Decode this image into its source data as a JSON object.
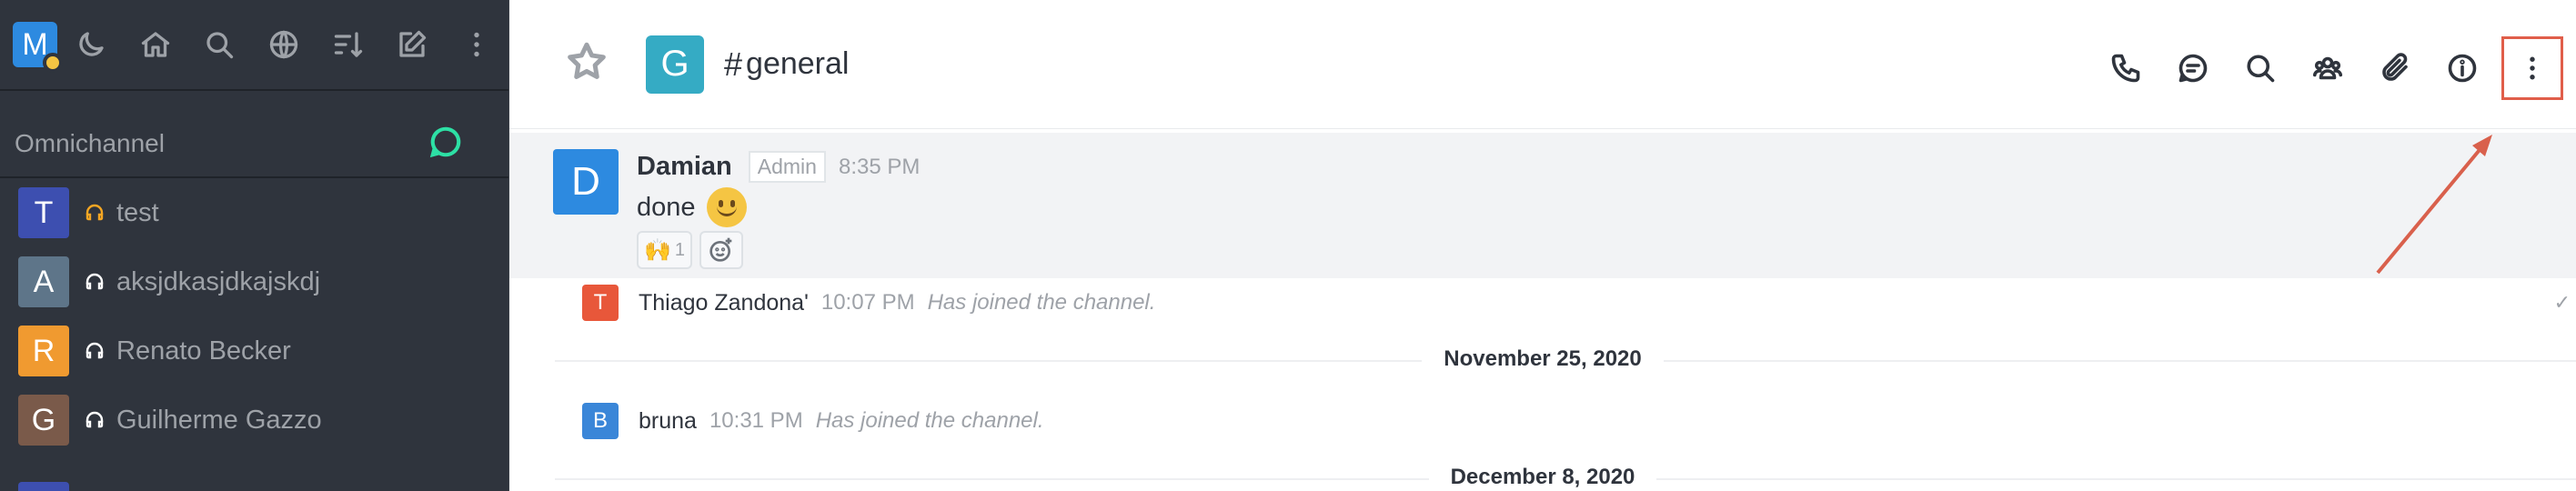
{
  "sidebar": {
    "user": {
      "initial": "M"
    },
    "toolbar_icons": [
      "moon-icon",
      "home-icon",
      "search-icon",
      "globe-icon",
      "sort-icon",
      "edit-icon",
      "kebab-icon"
    ],
    "omnichannel": {
      "label": "Omnichannel"
    },
    "rooms": [
      {
        "initial": "T",
        "name": "test",
        "avatar_color": "#3d4fb0",
        "icon_color": "#f5a623"
      },
      {
        "initial": "A",
        "name": "aksjdkasjdkajskdj",
        "avatar_color": "#5e7589",
        "icon_color": "#ffffff"
      },
      {
        "initial": "R",
        "name": "Renato Becker",
        "avatar_color": "#f09a30",
        "icon_color": "#ffffff"
      },
      {
        "initial": "G",
        "name": "Guilherme Gazzo",
        "avatar_color": "#7a5a4a",
        "icon_color": "#ffffff"
      }
    ]
  },
  "header": {
    "channel_initial": "G",
    "channel_name": "general",
    "actions": [
      "call-icon",
      "discussion-icon",
      "search-icon",
      "members-icon",
      "attachment-icon",
      "info-icon",
      "kebab-menu-icon"
    ]
  },
  "messages": {
    "main": {
      "initial": "D",
      "author": "Damian",
      "role": "Admin",
      "time": "8:35 PM",
      "text": "done",
      "reaction_count": "1"
    },
    "system": [
      {
        "initial": "T",
        "author": "Thiago Zandona'",
        "time": "10:07 PM",
        "text": "Has joined the channel.",
        "avatar_color": "#e8573a"
      },
      {
        "initial": "B",
        "author": "bruna",
        "time": "10:31 PM",
        "text": "Has joined the channel.",
        "avatar_color": "#3a86d8"
      }
    ],
    "dividers": [
      "November 25, 2020",
      "December 8, 2020"
    ]
  }
}
